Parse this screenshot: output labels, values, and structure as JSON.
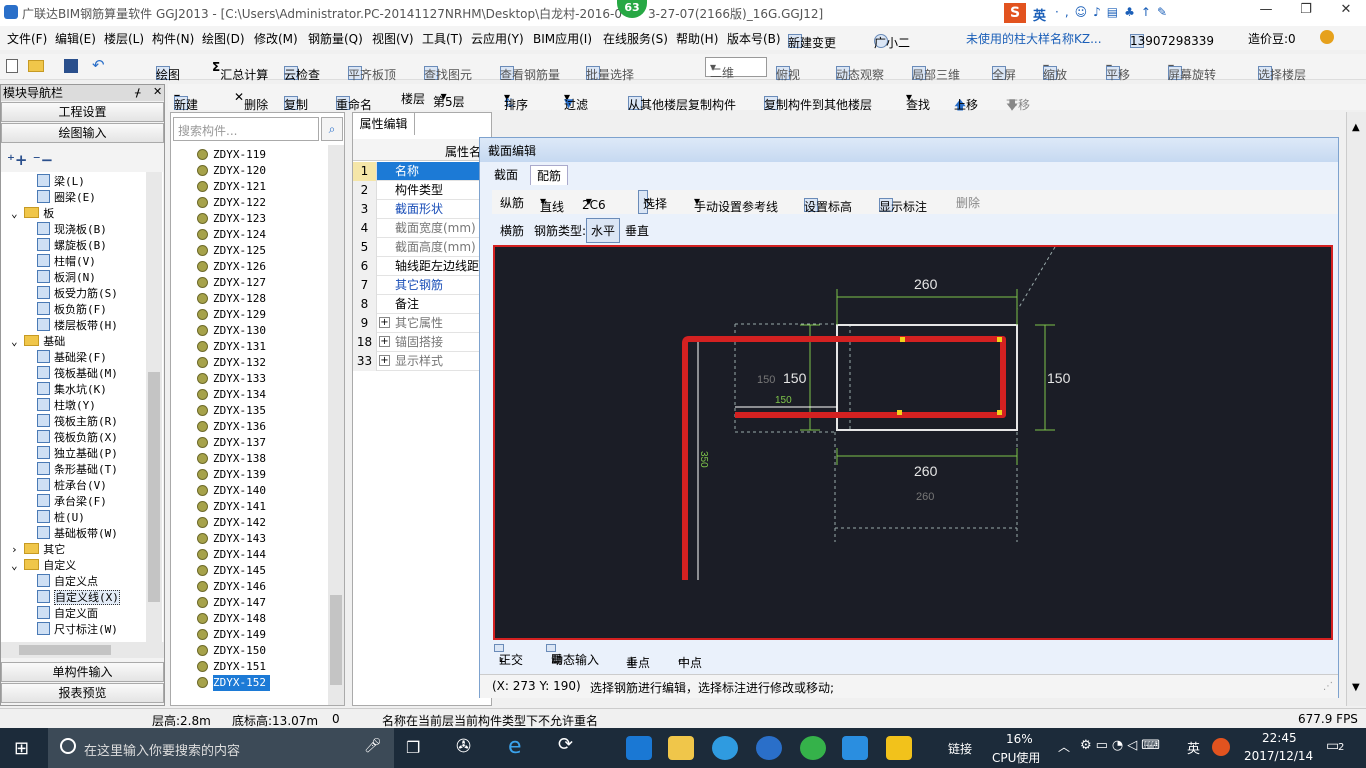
{
  "app": {
    "title": "广联达BIM钢筋算量软件 GGJ2013 - [C:\\Users\\Administrator.PC-20141127NRHM\\Desktop\\白龙村-2016-0",
    "title_tail": "3-27-07(2166版)_16G.GGJ12]",
    "badge": "63",
    "ime": "英"
  },
  "menu": [
    "文件(F)",
    "编辑(E)",
    "楼层(L)",
    "构件(N)",
    "绘图(D)",
    "修改(M)",
    "钢筋量(Q)",
    "视图(V)",
    "工具(T)",
    "云应用(Y)",
    "BIM应用(I)",
    "在线服务(S)",
    "帮助(H)",
    "版本号(B)",
    "新建变更",
    "广小二",
    "未使用的柱大样名称KZ...",
    "13907298339",
    "造价豆:0"
  ],
  "toolbar1": [
    "绘图",
    "汇总计算",
    "云检查",
    "平齐板顶",
    "查找图元",
    "查看钢筋量",
    "批量选择",
    "二维",
    "俯视",
    "动态观察",
    "局部三维",
    "全屏",
    "缩放",
    "平移",
    "屏幕旋转",
    "选择楼层"
  ],
  "toolbar2": [
    "新建",
    "删除",
    "复制",
    "重命名",
    "楼层",
    "第5层",
    "排序",
    "过滤",
    "从其他楼层复制构件",
    "复制构件到其他楼层",
    "查找",
    "上移",
    "下移"
  ],
  "nav": {
    "title": "模块导航栏",
    "buttons": [
      "工程设置",
      "绘图输入"
    ],
    "bottom": [
      "单构件输入",
      "报表预览"
    ],
    "tree": [
      {
        "t": "梁(L)",
        "lvl": 3,
        "k": "item"
      },
      {
        "t": "圈梁(E)",
        "lvl": 3,
        "k": "item"
      },
      {
        "t": "板",
        "lvl": 1,
        "k": "folder"
      },
      {
        "t": "现浇板(B)",
        "lvl": 3,
        "k": "item"
      },
      {
        "t": "螺旋板(B)",
        "lvl": 3,
        "k": "item"
      },
      {
        "t": "柱帽(V)",
        "lvl": 3,
        "k": "item"
      },
      {
        "t": "板洞(N)",
        "lvl": 3,
        "k": "item"
      },
      {
        "t": "板受力筋(S)",
        "lvl": 3,
        "k": "item"
      },
      {
        "t": "板负筋(F)",
        "lvl": 3,
        "k": "item"
      },
      {
        "t": "楼层板带(H)",
        "lvl": 3,
        "k": "item"
      },
      {
        "t": "基础",
        "lvl": 1,
        "k": "folder"
      },
      {
        "t": "基础梁(F)",
        "lvl": 3,
        "k": "item"
      },
      {
        "t": "筏板基础(M)",
        "lvl": 3,
        "k": "item"
      },
      {
        "t": "集水坑(K)",
        "lvl": 3,
        "k": "item"
      },
      {
        "t": "柱墩(Y)",
        "lvl": 3,
        "k": "item"
      },
      {
        "t": "筏板主筋(R)",
        "lvl": 3,
        "k": "item"
      },
      {
        "t": "筏板负筋(X)",
        "lvl": 3,
        "k": "item"
      },
      {
        "t": "独立基础(P)",
        "lvl": 3,
        "k": "item"
      },
      {
        "t": "条形基础(T)",
        "lvl": 3,
        "k": "item"
      },
      {
        "t": "桩承台(V)",
        "lvl": 3,
        "k": "item"
      },
      {
        "t": "承台梁(F)",
        "lvl": 3,
        "k": "item"
      },
      {
        "t": "桩(U)",
        "lvl": 3,
        "k": "item"
      },
      {
        "t": "基础板带(W)",
        "lvl": 3,
        "k": "item"
      },
      {
        "t": "其它",
        "lvl": 1,
        "k": "folder"
      },
      {
        "t": "自定义",
        "lvl": 1,
        "k": "folder"
      },
      {
        "t": "自定义点",
        "lvl": 3,
        "k": "item"
      },
      {
        "t": "自定义线(X)",
        "lvl": 3,
        "k": "item"
      },
      {
        "t": "自定义面",
        "lvl": 3,
        "k": "item"
      },
      {
        "t": "尺寸标注(W)",
        "lvl": 3,
        "k": "item"
      }
    ]
  },
  "components": {
    "placeholder": "搜索构件...",
    "items": [
      "ZDYX-119",
      "ZDYX-120",
      "ZDYX-121",
      "ZDYX-122",
      "ZDYX-123",
      "ZDYX-124",
      "ZDYX-125",
      "ZDYX-126",
      "ZDYX-127",
      "ZDYX-128",
      "ZDYX-129",
      "ZDYX-130",
      "ZDYX-131",
      "ZDYX-132",
      "ZDYX-133",
      "ZDYX-134",
      "ZDYX-135",
      "ZDYX-136",
      "ZDYX-137",
      "ZDYX-138",
      "ZDYX-139",
      "ZDYX-140",
      "ZDYX-141",
      "ZDYX-142",
      "ZDYX-143",
      "ZDYX-144",
      "ZDYX-145",
      "ZDYX-146",
      "ZDYX-147",
      "ZDYX-148",
      "ZDYX-149",
      "ZDYX-150",
      "ZDYX-151",
      "ZDYX-152"
    ],
    "selected": "ZDYX-152"
  },
  "props": {
    "tab": "属性编辑",
    "header": "属性名",
    "rows": [
      {
        "n": "1",
        "l": "名称",
        "c": "blue",
        "sel": true
      },
      {
        "n": "2",
        "l": "构件类型",
        "c": "black"
      },
      {
        "n": "3",
        "l": "截面形状",
        "c": "blue"
      },
      {
        "n": "4",
        "l": "截面宽度(mm)",
        "c": "gray"
      },
      {
        "n": "5",
        "l": "截面高度(mm)",
        "c": "gray"
      },
      {
        "n": "6",
        "l": "轴线距左边线距",
        "c": "black"
      },
      {
        "n": "7",
        "l": "其它钢筋",
        "c": "blue"
      },
      {
        "n": "8",
        "l": "备注",
        "c": "black"
      },
      {
        "n": "9",
        "l": "其它属性",
        "c": "gray",
        "plus": true
      },
      {
        "n": "18",
        "l": "锚固搭接",
        "c": "gray",
        "plus": true
      },
      {
        "n": "33",
        "l": "显示样式",
        "c": "gray",
        "plus": true
      }
    ]
  },
  "dialog": {
    "title": "截面编辑",
    "tabs": [
      "截面",
      "配筋"
    ],
    "tool1": [
      "纵筋",
      "直线",
      "2C6",
      "选择",
      "手动设置参考线",
      "设置标高",
      "显示标注",
      "删除"
    ],
    "tool2": [
      "横筋",
      "钢筋类型:",
      "水平",
      "垂直"
    ],
    "bottom": [
      "正交",
      "动态输入",
      "垂点",
      "中点"
    ],
    "coords": "(X: 273 Y: 190)",
    "hint": "选择钢筋进行编辑，选择标注进行修改或移动;",
    "dims": {
      "top": "260",
      "right": "150",
      "left": "150",
      "left_small": "150",
      "bottom": "260",
      "bottom_gray": "260",
      "inner": "150",
      "vertical": "350"
    }
  },
  "status": {
    "floor_height": "层高:2.8m",
    "base_height": "底标高:13.07m",
    "zero": "0",
    "message": "名称在当前层当前构件类型下不允许重名",
    "fps": "677.9 FPS"
  },
  "taskbar": {
    "search": "在这里输入你要搜索的内容",
    "link": "链接",
    "cpu": "16%",
    "cpu_label": "CPU使用",
    "ime": "英",
    "time": "22:45",
    "date": "2017/12/14",
    "notif": "2"
  },
  "colors": {
    "rebar": "#d42121",
    "canvas": "#1b1d26",
    "section": "#e6e6e6",
    "dim": "#7ec44a",
    "select": "#1c7ad6"
  }
}
